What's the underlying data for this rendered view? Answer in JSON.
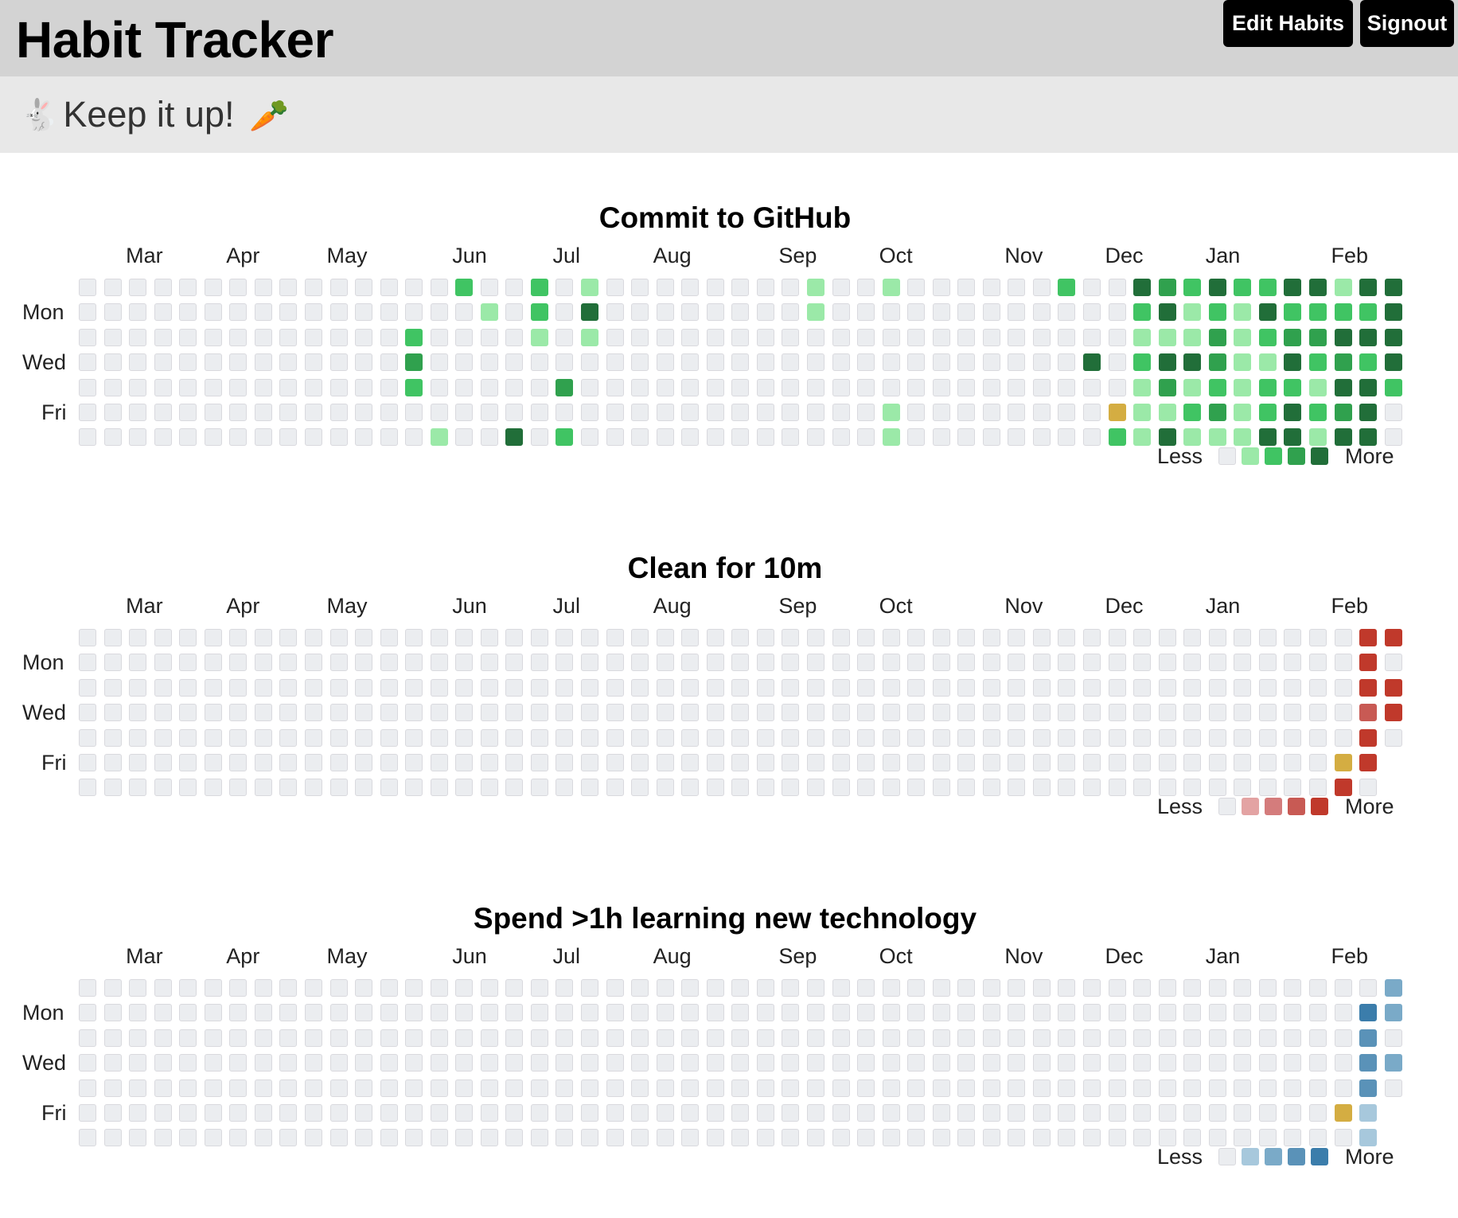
{
  "header": {
    "title": "Habit Tracker",
    "edit_label": "Edit Habits",
    "signout_label": "Signout"
  },
  "banner": {
    "rabbit_emoji": "🐇",
    "text": "Keep it up!",
    "carrot_emoji": "🥕"
  },
  "months": [
    "Mar",
    "Apr",
    "May",
    "Jun",
    "Jul",
    "Aug",
    "Sep",
    "Oct",
    "Nov",
    "Dec",
    "Jan",
    "Feb"
  ],
  "month_start_weeks": [
    2,
    6,
    10,
    15,
    19,
    23,
    28,
    32,
    37,
    41,
    45,
    50
  ],
  "day_labels": [
    "Mon",
    "Wed",
    "Fri"
  ],
  "legend": {
    "less": "Less",
    "more": "More"
  },
  "week_count": 53,
  "habits": [
    {
      "name": "Commit to GitHub",
      "palette": [
        "#ebedf0",
        "#9be9a8",
        "#40c463",
        "#30a14e",
        "#216e39"
      ],
      "today_color": "#d4ad42",
      "today": {
        "week": 41,
        "day": 5
      },
      "last_week_days": 6,
      "filled": {
        "13": [
          0,
          0,
          2,
          3,
          2,
          0,
          0
        ],
        "14": [
          0,
          0,
          0,
          0,
          0,
          0,
          1
        ],
        "15": [
          2,
          0,
          0,
          0,
          0,
          0,
          0
        ],
        "16": [
          0,
          1,
          0,
          0,
          0,
          0,
          0
        ],
        "17": [
          0,
          0,
          0,
          0,
          0,
          0,
          4
        ],
        "18": [
          2,
          2,
          1,
          0,
          0,
          0,
          0
        ],
        "19": [
          0,
          0,
          0,
          0,
          3,
          0,
          2
        ],
        "20": [
          1,
          4,
          1,
          0,
          0,
          0,
          0
        ],
        "29": [
          1,
          1,
          0,
          0,
          0,
          0,
          0
        ],
        "32": [
          1,
          0,
          0,
          0,
          0,
          1,
          1
        ],
        "39": [
          2,
          0,
          0,
          0,
          0,
          0,
          0
        ],
        "40": [
          0,
          0,
          0,
          4,
          0,
          0,
          0
        ],
        "41": [
          0,
          0,
          0,
          0,
          0,
          0,
          2
        ],
        "42": [
          4,
          2,
          1,
          2,
          1,
          1,
          1
        ],
        "43": [
          3,
          4,
          1,
          4,
          3,
          1,
          4
        ],
        "44": [
          2,
          1,
          1,
          4,
          1,
          2,
          1
        ],
        "45": [
          4,
          2,
          3,
          3,
          2,
          3,
          1
        ],
        "46": [
          2,
          1,
          1,
          1,
          1,
          1,
          1
        ],
        "47": [
          2,
          4,
          2,
          1,
          2,
          2,
          4
        ],
        "48": [
          4,
          2,
          3,
          4,
          2,
          4,
          4
        ],
        "49": [
          4,
          2,
          3,
          2,
          1,
          2,
          1
        ],
        "50": [
          1,
          2,
          4,
          3,
          4,
          3,
          4
        ],
        "51": [
          4,
          2,
          4,
          2,
          4,
          4,
          4
        ],
        "52": [
          4,
          4,
          4,
          4,
          2,
          0,
          0
        ]
      }
    },
    {
      "name": "Clean for 10m",
      "palette": [
        "#ebedf0",
        "#e3a3a3",
        "#d47c7c",
        "#c85a54",
        "#c0392b"
      ],
      "today_color": "#d4ad42",
      "today": {
        "week": 50,
        "day": 5
      },
      "last_week_days": 4,
      "filled": {
        "50": [
          0,
          0,
          0,
          0,
          0,
          0,
          4
        ],
        "51": [
          4,
          4,
          4,
          3,
          4,
          4,
          0
        ],
        "52": [
          4,
          0,
          4,
          4,
          0,
          0,
          0
        ]
      }
    },
    {
      "name": "Spend >1h learning new technology",
      "palette": [
        "#ebedf0",
        "#a7c8dc",
        "#7aaac8",
        "#5a92b8",
        "#3b7dab"
      ],
      "today_color": "#d4ad42",
      "today": {
        "week": 50,
        "day": 5
      },
      "last_week_days": 4,
      "filled": {
        "51": [
          0,
          4,
          3,
          3,
          3,
          1,
          1
        ],
        "52": [
          2,
          2,
          0,
          2,
          0,
          0,
          0
        ]
      }
    }
  ]
}
